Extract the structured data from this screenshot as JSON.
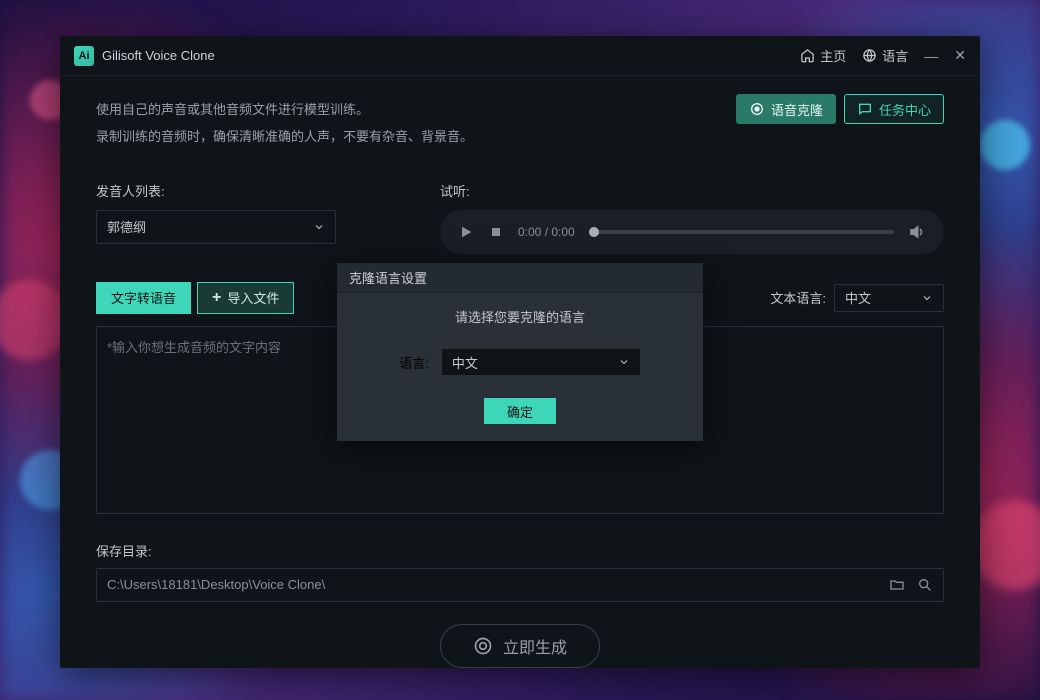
{
  "app": {
    "icon_text": "Ai",
    "title": "Gilisoft Voice Clone"
  },
  "titlebar": {
    "home": "主页",
    "language": "语言"
  },
  "hints": {
    "line1": "使用自己的声音或其他音频文件进行模型训练。",
    "line2": "录制训练的音频时，确保清晰准确的人声，不要有杂音、背景音。"
  },
  "buttons": {
    "voice_clone": "语音克隆",
    "task_center": "任务中心"
  },
  "speaker": {
    "label": "发音人列表:",
    "value": "郭德纲"
  },
  "preview": {
    "label": "试听:",
    "time": "0:00 / 0:00"
  },
  "tabs": {
    "tts": "文字转语音",
    "import": "导入文件"
  },
  "text_lang": {
    "label": "文本语言:",
    "value": "中文"
  },
  "textarea": {
    "placeholder": "*输入你想生成音频的文字内容"
  },
  "save": {
    "label": "保存目录:",
    "path": "C:\\Users\\18181\\Desktop\\Voice Clone\\"
  },
  "generate": "立即生成",
  "modal": {
    "title": "克隆语言设置",
    "prompt": "请选择您要克隆的语言",
    "lang_label": "语言:",
    "lang_value": "中文",
    "ok": "确定"
  }
}
